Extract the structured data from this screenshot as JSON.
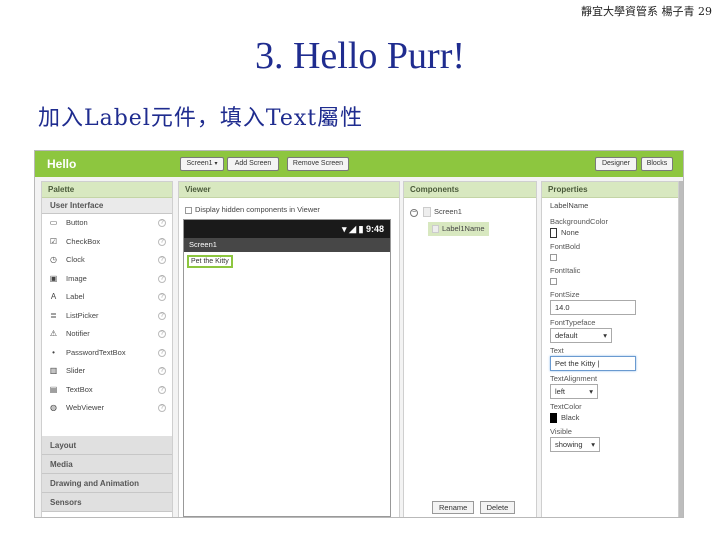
{
  "slide": {
    "header": "靜宜大學資管系 楊子青 29",
    "title": "3. Hello Purr!",
    "subtitle": "加入Label元件，填入Text屬性"
  },
  "app": {
    "project_name": "Hello",
    "toolbar": {
      "screen_dropdown": "Screen1",
      "add_screen": "Add Screen",
      "remove_screen": "Remove Screen",
      "designer": "Designer",
      "blocks": "Blocks"
    },
    "palette": {
      "header": "Palette",
      "open_category": "User Interface",
      "items": [
        {
          "label": "Button",
          "icon": "button-icon"
        },
        {
          "label": "CheckBox",
          "icon": "checkbox-icon"
        },
        {
          "label": "Clock",
          "icon": "clock-icon"
        },
        {
          "label": "Image",
          "icon": "image-icon"
        },
        {
          "label": "Label",
          "icon": "label-icon"
        },
        {
          "label": "ListPicker",
          "icon": "listpicker-icon"
        },
        {
          "label": "Notifier",
          "icon": "warning-icon"
        },
        {
          "label": "PasswordTextBox",
          "icon": "password-icon"
        },
        {
          "label": "Slider",
          "icon": "slider-icon"
        },
        {
          "label": "TextBox",
          "icon": "textbox-icon"
        },
        {
          "label": "WebViewer",
          "icon": "globe-icon"
        }
      ],
      "categories": [
        "Layout",
        "Media",
        "Drawing and Animation",
        "Sensors"
      ]
    },
    "viewer": {
      "header": "Viewer",
      "hidden_checkbox_label": "Display hidden components in Viewer",
      "time": "9:48",
      "screen_title": "Screen1",
      "label_text": "Pet the Kitty"
    },
    "components": {
      "header": "Components",
      "root": "Screen1",
      "child": "Label1Name",
      "rename": "Rename",
      "delete": "Delete"
    },
    "properties": {
      "header": "Properties",
      "component_name": "LabelName",
      "background_color_label": "BackgroundColor",
      "background_color_value": "None",
      "font_bold_label": "FontBold",
      "font_italic_label": "FontItalic",
      "font_size_label": "FontSize",
      "font_size_value": "14.0",
      "font_typeface_label": "FontTypeface",
      "font_typeface_value": "default",
      "text_label": "Text",
      "text_value": "Pet the Kitty",
      "text_alignment_label": "TextAlignment",
      "text_alignment_value": "left",
      "text_color_label": "TextColor",
      "text_color_value": "Black",
      "visible_label": "Visible",
      "visible_value": "showing"
    },
    "colors": {
      "accent_green": "#8dc63f",
      "title_blue": "#1f2c8f"
    }
  }
}
